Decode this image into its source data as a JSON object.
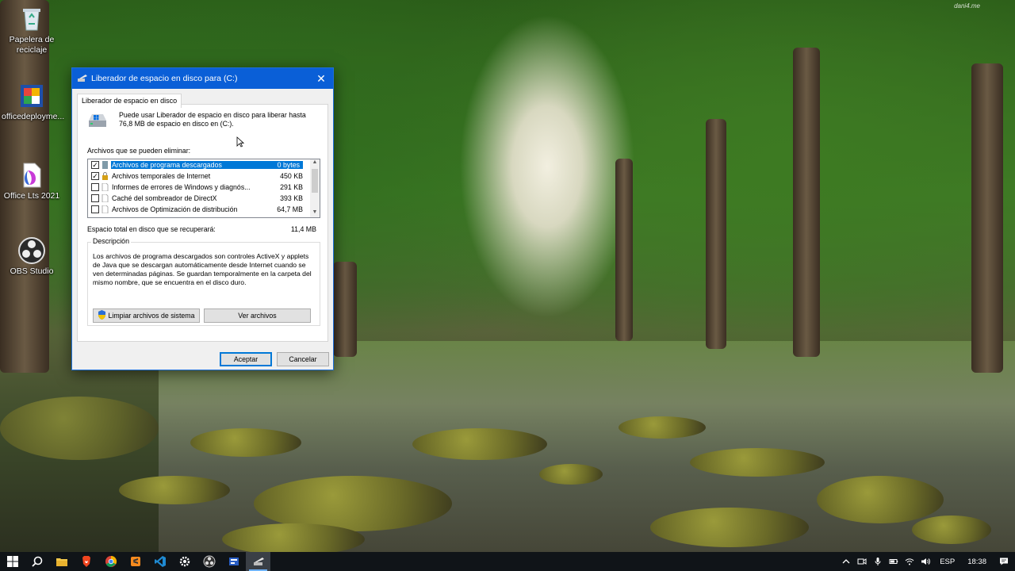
{
  "desktop": {
    "icons": [
      {
        "label": "Papelera de reciclaje",
        "icon": "recycle-bin-icon"
      },
      {
        "label": "officedeployme...",
        "icon": "office-deployment-icon"
      },
      {
        "label": "Office Lts 2021",
        "icon": "office-file-icon"
      },
      {
        "label": "OBS Studio",
        "icon": "obs-studio-icon"
      }
    ],
    "watermark": "dani4.me"
  },
  "dialog": {
    "title": "Liberador de espacio en disco para  (C:)",
    "tab_label": "Liberador de espacio en disco",
    "intro_text": "Puede usar Liberador de espacio en disco para liberar hasta 76,8 MB de espacio en disco en  (C:).",
    "files_label": "Archivos que se pueden eliminar:",
    "files": [
      {
        "name": "Archivos de programa descargados",
        "size": "0 bytes",
        "checked": true,
        "selected": true
      },
      {
        "name": "Archivos temporales de Internet",
        "size": "450 KB",
        "checked": true,
        "selected": false
      },
      {
        "name": "Informes de errores de Windows y diagnós...",
        "size": "291 KB",
        "checked": false,
        "selected": false
      },
      {
        "name": "Caché del sombreador de DirectX",
        "size": "393 KB",
        "checked": false,
        "selected": false
      },
      {
        "name": "Archivos de Optimización de distribución",
        "size": "64,7 MB",
        "checked": false,
        "selected": false
      }
    ],
    "total_label": "Espacio total en disco que se recuperará:",
    "total_value": "11,4 MB",
    "description_legend": "Descripción",
    "description_text": "Los archivos de programa descargados son controles ActiveX y applets de Java que se descargan automáticamente desde Internet cuando se ven determinadas páginas. Se guardan temporalmente en la carpeta del mismo nombre, que se encuentra en el disco duro.",
    "clean_system_button": "Limpiar archivos de sistema",
    "view_files_button": "Ver archivos",
    "ok_button": "Aceptar",
    "cancel_button": "Cancelar",
    "close_glyph": "✕"
  },
  "taskbar": {
    "apps": [
      "start-icon",
      "search-icon",
      "file-explorer-icon",
      "brave-icon",
      "chrome-icon",
      "sublime-icon",
      "vscode-icon",
      "settings-icon",
      "obs-icon",
      "office-deploy-icon",
      "disk-cleanup-icon"
    ],
    "active_app": "disk-cleanup-icon",
    "language": "ESP",
    "time": "18:38"
  },
  "colors": {
    "titlebar": "#0a5fd7",
    "selection": "#0078d7",
    "taskbar": "#101418"
  }
}
